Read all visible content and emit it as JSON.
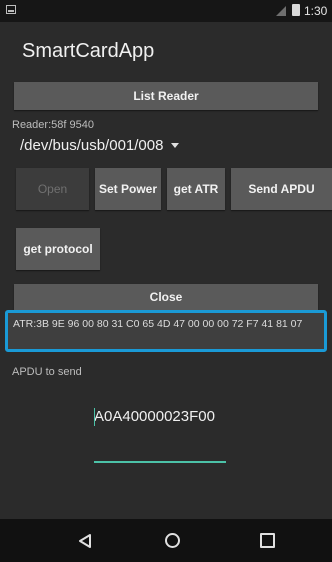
{
  "status_bar": {
    "time": "1:30"
  },
  "app": {
    "title": "SmartCardApp"
  },
  "buttons": {
    "list_reader": "List Reader",
    "open": "Open",
    "set_power": "Set Power",
    "get_atr": "get ATR",
    "send_apdu": "Send APDU",
    "get_protocol": "get protocol",
    "close": "Close"
  },
  "reader": {
    "label": "Reader:58f 9540",
    "selected_device": "/dev/bus/usb/001/008"
  },
  "atr": {
    "text": "ATR:3B 9E 96 00 80 31 C0 65 4D 47 00 00 00 72 F7 41 81 07"
  },
  "apdu": {
    "label": "APDU to send",
    "value": "A0A40000023F00"
  },
  "colors": {
    "highlight": "#1a9ad6",
    "input_accent": "#4cc2a8",
    "button": "#5a5a5a"
  },
  "navigation": {
    "back_icon": "back-triangle",
    "home_icon": "home-circle",
    "recent_icon": "recent-square"
  }
}
